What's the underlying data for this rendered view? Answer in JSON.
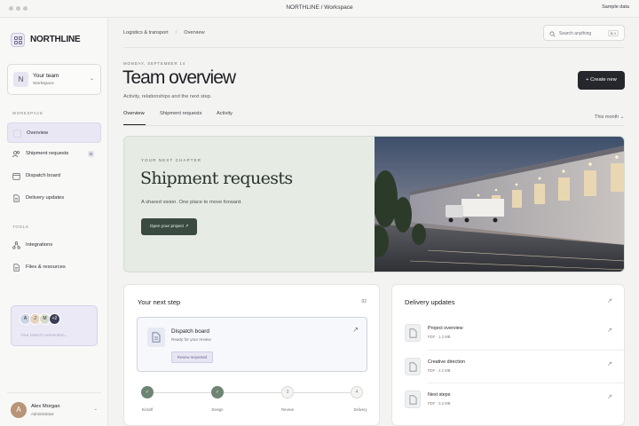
{
  "window": {
    "title": "NORTHLINE / Workspace",
    "sample_label": "Sample data"
  },
  "brand": {
    "name": "NORTHLINE"
  },
  "team": {
    "initial": "N",
    "name": "Your team",
    "subtitle": "Workspace"
  },
  "sidebar": {
    "workspace_label": "WORKSPACE",
    "workspace_items": [
      {
        "label": "Overview"
      },
      {
        "label": "Shipment requests",
        "badge": "8"
      },
      {
        "label": "Dispatch board"
      },
      {
        "label": "Delivery updates"
      }
    ],
    "tools_label": "TOOLS",
    "tools_items": [
      {
        "label": "Integrations"
      },
      {
        "label": "Files & resources"
      }
    ],
    "collab": {
      "avatars": [
        "A",
        "J",
        "M"
      ],
      "more": "+2",
      "text": "Your team's connection..."
    },
    "user": {
      "initial": "A",
      "name": "Alex Morgan",
      "role": "Administrator"
    }
  },
  "header": {
    "breadcrumb": [
      "Logistics & transport",
      "Overview"
    ],
    "search_placeholder": "Search anything",
    "search_shortcut": "⌘ K"
  },
  "page": {
    "date": "MONDAY, SEPTEMBER 14",
    "title": "Team overview",
    "subtitle": "Activity, relationships and the next step.",
    "create_button": "+ Create new",
    "tabs": [
      "Overview",
      "Shipment requests",
      "Activity"
    ],
    "period": "This month ⌄"
  },
  "hero": {
    "kicker": "YOUR NEXT CHAPTER",
    "title": "Shipment requests",
    "subtitle": "A shared vision. One place to move forward.",
    "button": "Open your project ↗"
  },
  "next_step": {
    "title": "Your next step",
    "count": "02",
    "item": {
      "title": "Dispatch board",
      "status": "Ready for your review",
      "tag": "Review requested"
    },
    "steps": [
      {
        "label": "Kickoff",
        "state": "done",
        "mark": "✓"
      },
      {
        "label": "Design",
        "state": "done",
        "mark": "✓"
      },
      {
        "label": "Review",
        "state": "todo",
        "mark": "3"
      },
      {
        "label": "Delivery",
        "state": "todo",
        "mark": "4"
      }
    ]
  },
  "delivery": {
    "title": "Delivery updates",
    "docs": [
      {
        "title": "Project overview",
        "meta": "PDF · 1.2 MB"
      },
      {
        "title": "Creative direction",
        "meta": "PDF · 2.2 MB"
      },
      {
        "title": "Next steps",
        "meta": "PDF · 0.3 MB"
      }
    ]
  },
  "colors": {
    "accent": "#e9e7f3",
    "primary_button": "#26272c",
    "hero_bg": "#e6ebe4",
    "hero_button": "#3b4a40",
    "step_done": "#6e8573"
  }
}
